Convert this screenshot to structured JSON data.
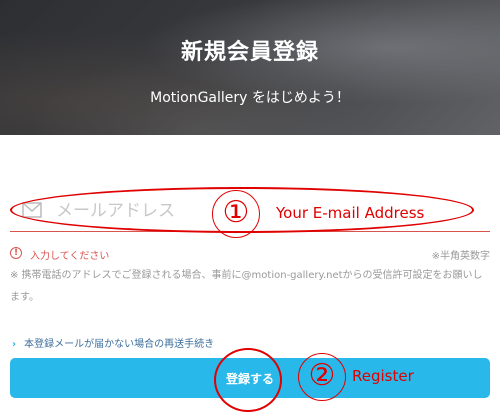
{
  "hero": {
    "title": "新規会員登録",
    "subtitle": "MotionGallery をはじめよう！"
  },
  "form": {
    "email_placeholder": "メールアドレス",
    "email_value": "",
    "error_message": "入力してください",
    "hint": "※半角英数字",
    "note": "※ 携帯電話のアドレスでご登録される場合、事前に@motion-gallery.netからの受信許可設定をお願いします。",
    "resend_link": "本登録メールが届かない場合の再送手続き",
    "register_button": "登録する"
  },
  "annotations": {
    "marker_1": "①",
    "label_1": "Your E-mail Address",
    "marker_2": "②",
    "label_2": "Register"
  },
  "colors": {
    "accent": "#29b8ea",
    "error": "#d9534f",
    "annotation": "#e00000",
    "link": "#3c6e9c"
  },
  "icons": {
    "email_field": "mail-icon",
    "error": "exclamation-circle-icon",
    "link": "chevron-right-icon"
  }
}
